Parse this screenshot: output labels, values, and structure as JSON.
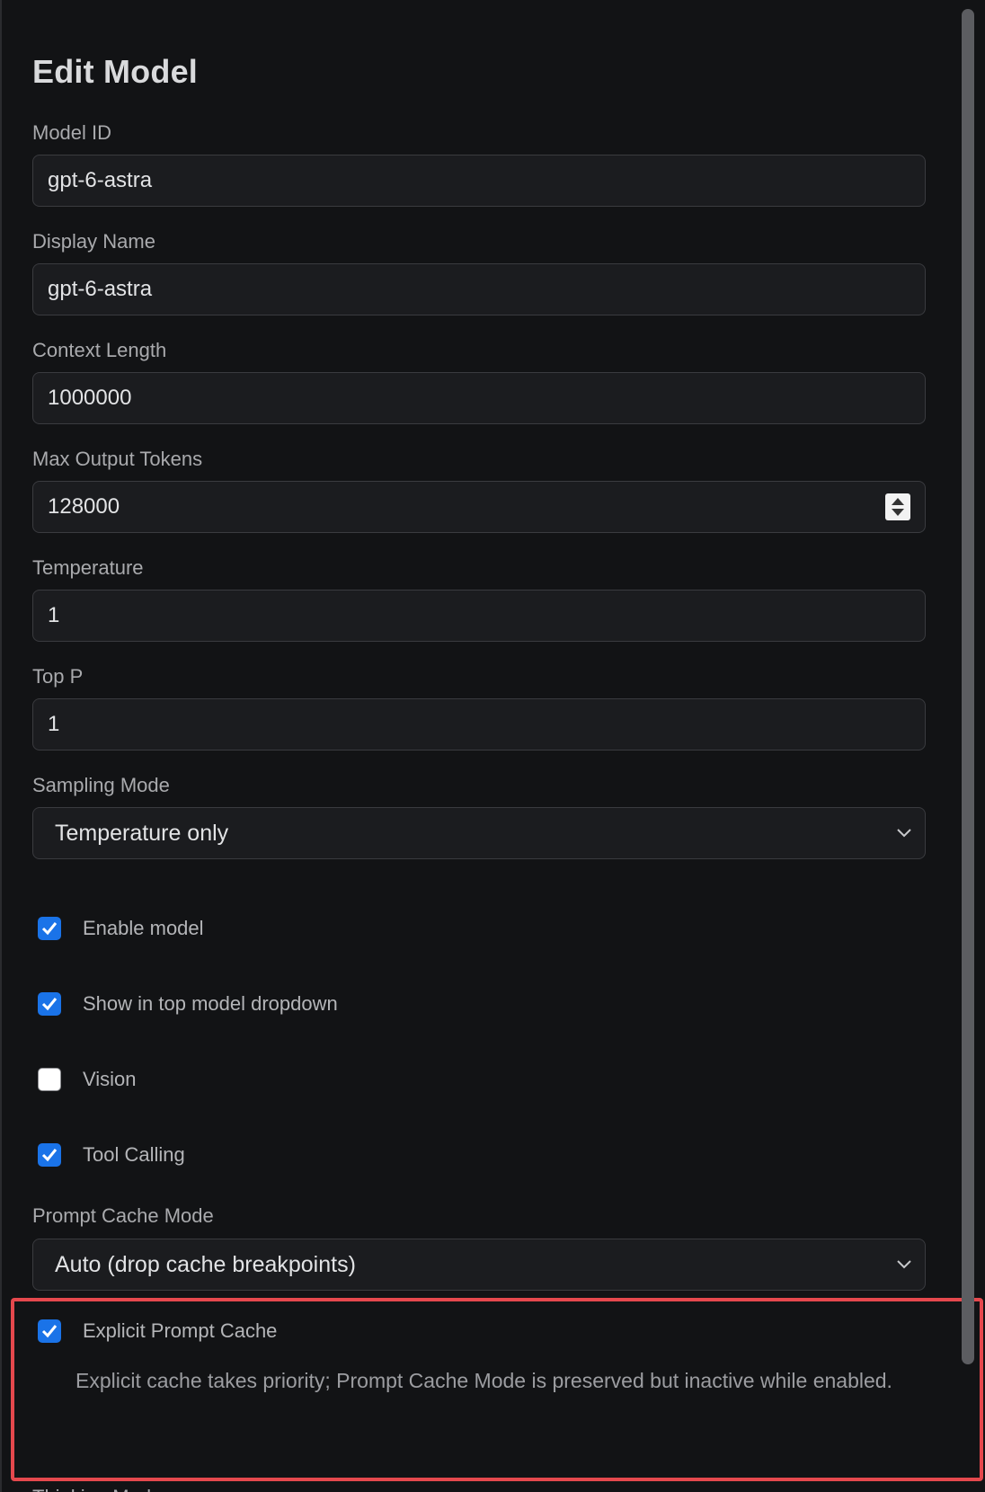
{
  "title": "Edit Model",
  "fields": {
    "model_id": {
      "label": "Model ID",
      "value": "gpt-6-astra"
    },
    "display_name": {
      "label": "Display Name",
      "value": "gpt-6-astra"
    },
    "context_length": {
      "label": "Context Length",
      "value": "1000000"
    },
    "max_output_tokens": {
      "label": "Max Output Tokens",
      "value": "128000"
    },
    "temperature": {
      "label": "Temperature",
      "value": "1"
    },
    "top_p": {
      "label": "Top P",
      "value": "1"
    },
    "sampling_mode": {
      "label": "Sampling Mode",
      "value": "Temperature only"
    }
  },
  "checkboxes": {
    "enable_model": {
      "label": "Enable model",
      "checked": true
    },
    "show_in_dropdown": {
      "label": "Show in top model dropdown",
      "checked": true
    },
    "vision": {
      "label": "Vision",
      "checked": false
    },
    "tool_calling": {
      "label": "Tool Calling",
      "checked": true
    }
  },
  "prompt_cache_mode": {
    "label": "Prompt Cache Mode",
    "value": "Auto (drop cache breakpoints)"
  },
  "explicit_prompt_cache": {
    "label": "Explicit Prompt Cache",
    "checked": true,
    "hint": "Explicit cache takes priority; Prompt Cache Mode is preserved but inactive while enabled."
  },
  "thinking_mode": {
    "label": "Thinking Mode"
  },
  "colors": {
    "background": "#121315",
    "accent": "#1a73e8",
    "highlight_border": "#e5484d"
  }
}
